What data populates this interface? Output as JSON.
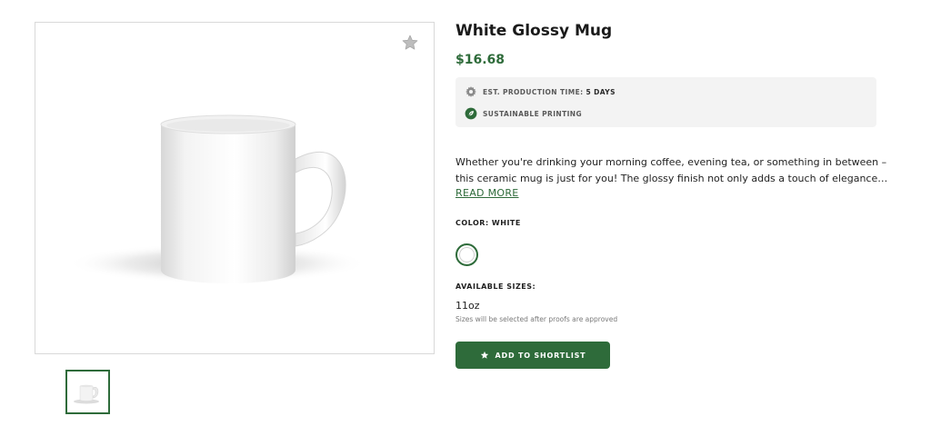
{
  "product": {
    "title": "White Glossy Mug",
    "price": "$16.68"
  },
  "features": {
    "production_label": "EST. PRODUCTION TIME:",
    "production_value": "5 DAYS",
    "production_icon": "gear-icon",
    "sustainable_label": "SUSTAINABLE PRINTING",
    "sustainable_icon": "leaf-icon"
  },
  "description": {
    "line1": "Whether you're drinking your morning coffee, evening tea, or something in between –",
    "line2": "this ceramic mug is just for you! The glossy finish not only adds a touch of elegance…",
    "read_more": "READ MORE"
  },
  "color": {
    "label": "COLOR: WHITE",
    "selected": "White",
    "swatch_hex": "#ffffff"
  },
  "sizes": {
    "label": "AVAILABLE SIZES:",
    "value": "11oz",
    "note": "Sizes will be selected after proofs are approved"
  },
  "actions": {
    "shortlist_label": "ADD TO SHORTLIST",
    "shortlist_icon": "star-icon",
    "favorite_icon": "star-icon"
  },
  "theme": {
    "accent": "#2e6b3a",
    "panel_bg": "#f3f3f3"
  }
}
